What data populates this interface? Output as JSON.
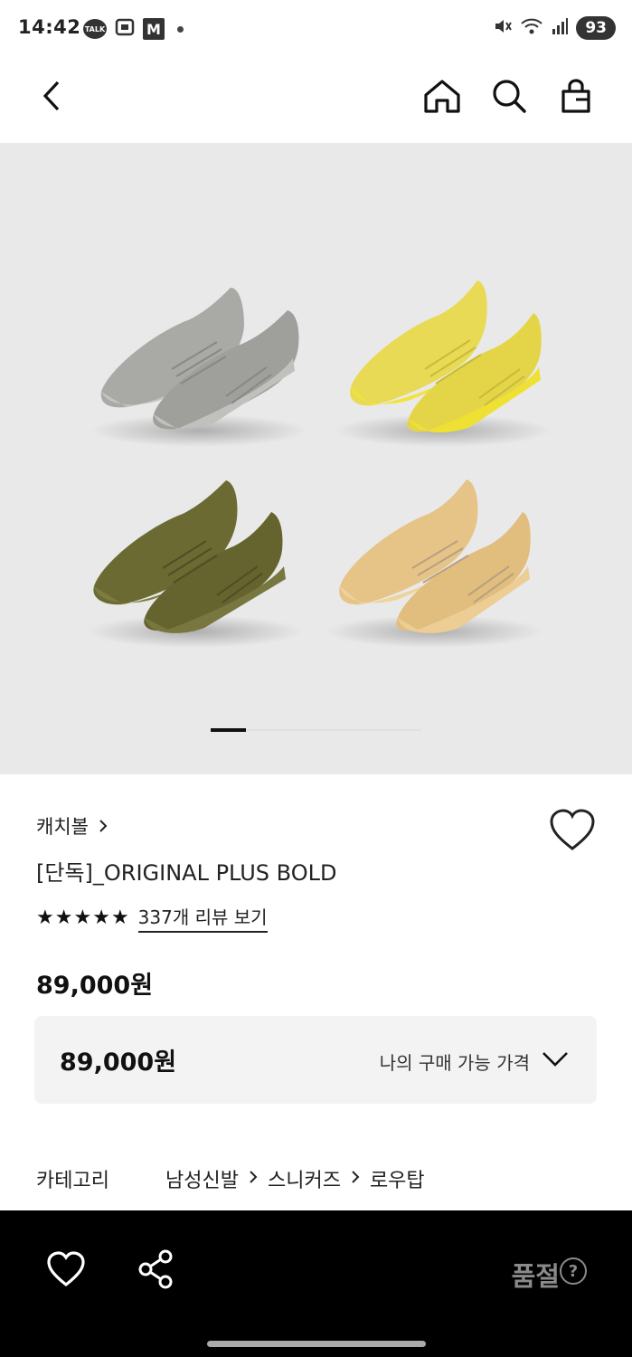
{
  "status_bar": {
    "time": "14:42",
    "talk_badge": "TALK",
    "m_badge": "M",
    "battery": "93"
  },
  "product": {
    "brand": "캐치볼",
    "name": "[단독]_ORIGINAL PLUS BOLD",
    "rating_stars": 5,
    "review_link": "337개 리뷰 보기",
    "price": "89,000원",
    "my_price": "89,000원",
    "my_price_label": "나의 구매 가능 가격",
    "image_pager": {
      "current": 1,
      "total": 6
    }
  },
  "category": {
    "label": "카테고리",
    "path": [
      "남성신발",
      "스니커즈",
      "로우탑"
    ]
  },
  "bottom_bar": {
    "soldout_label": "품절",
    "help_label": "?"
  },
  "colors": {
    "hero_bg": "#e9e9e9",
    "shoe_grey": "#a7a7a4",
    "shoe_yellow": "#eadc4a",
    "shoe_olive": "#6d6c34",
    "shoe_sand": "#e2c184"
  }
}
